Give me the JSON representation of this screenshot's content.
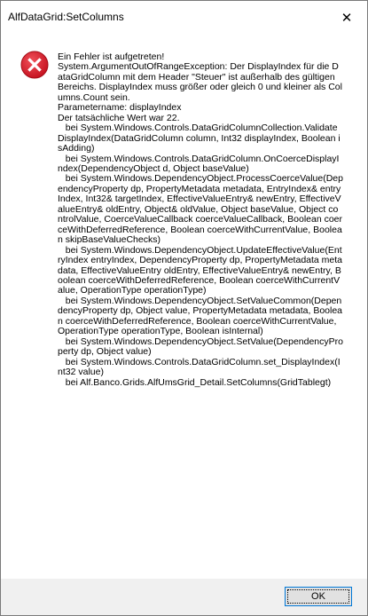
{
  "window": {
    "title": "AlfDataGrid:SetColumns"
  },
  "close_glyph": "✕",
  "icon": "error-icon",
  "colors": {
    "error_red": "#e81123",
    "button_border": "#0078d7",
    "footer_bg": "#f0f0f0"
  },
  "message": "Ein Fehler ist aufgetreten!\nSystem.ArgumentOutOfRangeException: Der DisplayIndex für die DataGridColumn mit dem Header \"Steuer\" ist außerhalb des gültigen Bereichs. DisplayIndex muss größer oder gleich 0 und kleiner als Columns.Count sein.\nParametername: displayIndex\nDer tatsächliche Wert war 22.\n   bei System.Windows.Controls.DataGridColumnCollection.ValidateDisplayIndex(DataGridColumn column, Int32 displayIndex, Boolean isAdding)\n   bei System.Windows.Controls.DataGridColumn.OnCoerceDisplayIndex(DependencyObject d, Object baseValue)\n   bei System.Windows.DependencyObject.ProcessCoerceValue(DependencyProperty dp, PropertyMetadata metadata, EntryIndex& entryIndex, Int32& targetIndex, EffectiveValueEntry& newEntry, EffectiveValueEntry& oldEntry, Object& oldValue, Object baseValue, Object controlValue, CoerceValueCallback coerceValueCallback, Boolean coerceWithDeferredReference, Boolean coerceWithCurrentValue, Boolean skipBaseValueChecks)\n   bei System.Windows.DependencyObject.UpdateEffectiveValue(EntryIndex entryIndex, DependencyProperty dp, PropertyMetadata metadata, EffectiveValueEntry oldEntry, EffectiveValueEntry& newEntry, Boolean coerceWithDeferredReference, Boolean coerceWithCurrentValue, OperationType operationType)\n   bei System.Windows.DependencyObject.SetValueCommon(DependencyProperty dp, Object value, PropertyMetadata metadata, Boolean coerceWithDeferredReference, Boolean coerceWithCurrentValue, OperationType operationType, Boolean isInternal)\n   bei System.Windows.DependencyObject.SetValue(DependencyProperty dp, Object value)\n   bei System.Windows.Controls.DataGridColumn.set_DisplayIndex(Int32 value)\n   bei Alf.Banco.Grids.AlfUmsGrid_Detail.SetColumns(GridTablegt)",
  "buttons": {
    "ok_label": "OK"
  }
}
